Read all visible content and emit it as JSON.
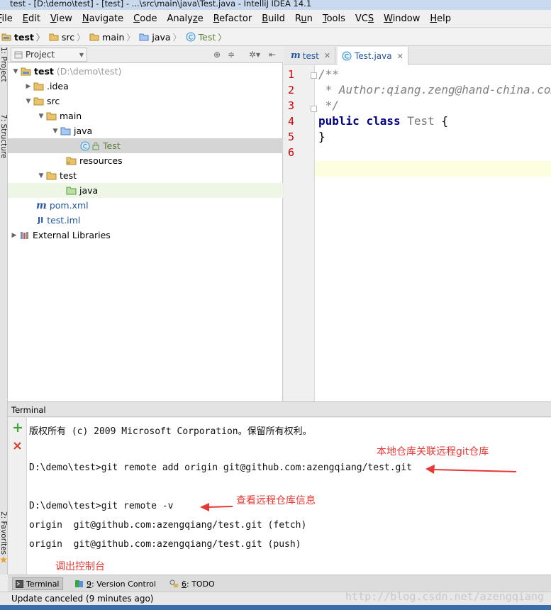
{
  "window": {
    "title": "test - [D:\\demo\\test] - [test] - ...\\src\\main\\java\\Test.java - IntelliJ IDEA 14.1"
  },
  "menu": [
    {
      "label": "File",
      "mnemonic": "F"
    },
    {
      "label": "Edit",
      "mnemonic": "E"
    },
    {
      "label": "View",
      "mnemonic": "V"
    },
    {
      "label": "Navigate",
      "mnemonic": "N"
    },
    {
      "label": "Code",
      "mnemonic": "C"
    },
    {
      "label": "Analyze",
      "mnemonic": "z"
    },
    {
      "label": "Refactor",
      "mnemonic": "R"
    },
    {
      "label": "Build",
      "mnemonic": "B"
    },
    {
      "label": "Run",
      "mnemonic": "u"
    },
    {
      "label": "Tools",
      "mnemonic": "T"
    },
    {
      "label": "VCS",
      "mnemonic": "S"
    },
    {
      "label": "Window",
      "mnemonic": "W"
    },
    {
      "label": "Help",
      "mnemonic": "H"
    }
  ],
  "breadcrumbs": [
    "test",
    "src",
    "main",
    "java",
    "Test"
  ],
  "left_strip": {
    "project": "1: Project",
    "structure": "7: Structure",
    "favorites": "2: Favorites"
  },
  "project_panel": {
    "selector": "Project",
    "tree": [
      {
        "label": "test",
        "hint": "(D:\\demo\\test)"
      },
      {
        "label": ".idea"
      },
      {
        "label": "src"
      },
      {
        "label": "main"
      },
      {
        "label": "java"
      },
      {
        "label": "Test"
      },
      {
        "label": "resources"
      },
      {
        "label": "test"
      },
      {
        "label": "java"
      },
      {
        "label": "pom.xml"
      },
      {
        "label": "test.iml"
      },
      {
        "label": "External Libraries"
      }
    ]
  },
  "editor": {
    "tabs": [
      {
        "label": "test"
      },
      {
        "label": "Test.java"
      }
    ],
    "line_numbers": [
      "1",
      "2",
      "3",
      "4",
      "5",
      "6"
    ],
    "code": {
      "line1": "/**",
      "line2": " * Author:qiang.zeng@hand-china.com",
      "line3": " */",
      "kw_public": "public",
      "kw_class": "class",
      "class_name": "Test",
      "brace_open": "{",
      "brace_close": "}"
    }
  },
  "terminal": {
    "title": "Terminal",
    "lines": [
      "版权所有 (c) 2009 Microsoft Corporation。保留所有权利。",
      "D:\\demo\\test>git remote add origin git@github.com:azengqiang/test.git",
      "D:\\demo\\test>git remote -v",
      "origin  git@github.com:azengqiang/test.git (fetch)",
      "origin  git@github.com:azengqiang/test.git (push)"
    ],
    "annotations": {
      "remote_add": "本地仓库关联远程git仓库",
      "remote_v": "查看远程仓库信息",
      "terminal_btn": "调出控制台"
    }
  },
  "tool_windows": {
    "terminal": "Terminal",
    "vcs_num": "9",
    "vcs": ": Version Control",
    "todo_num": "6",
    "todo": ": TODO"
  },
  "status": {
    "message": "Update canceled (9 minutes ago)"
  },
  "watermark": "http://blog.csdn.net/azengqiang",
  "colors": {
    "annotation": "#e53935",
    "line_number": "#cc0000",
    "keyword": "#000080"
  }
}
